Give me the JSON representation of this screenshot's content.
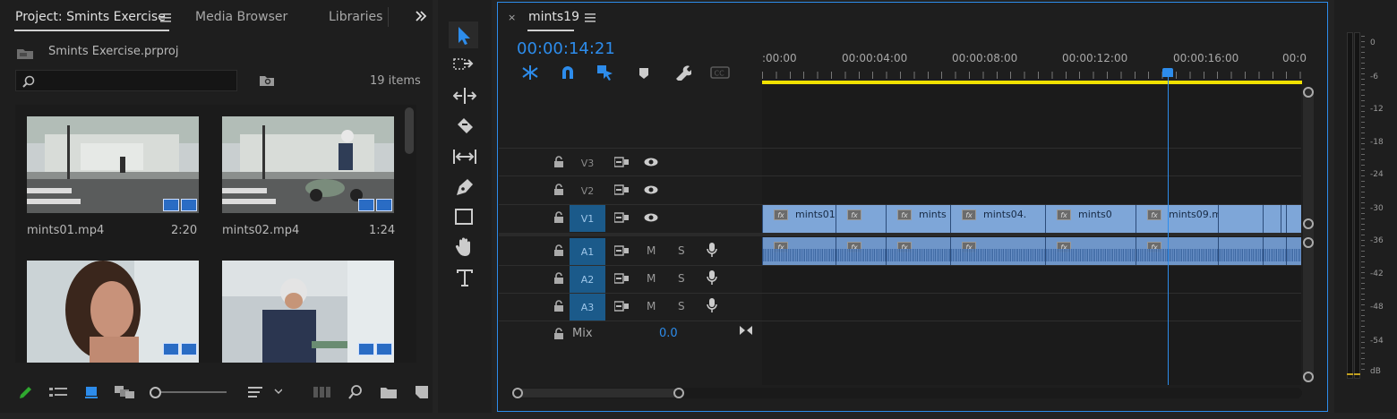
{
  "project_panel": {
    "tabs": [
      "Project: Smints Exercise",
      "Media Browser",
      "Libraries"
    ],
    "file_name": "Smints Exercise.prproj",
    "search_placeholder": "",
    "item_count": "19 items",
    "items": [
      {
        "name": "mints01.mp4",
        "duration": "2:20"
      },
      {
        "name": "mints02.mp4",
        "duration": "1:24"
      },
      {
        "name": "",
        "duration": ""
      },
      {
        "name": "",
        "duration": ""
      }
    ]
  },
  "toolbar": {
    "tools": [
      "selection-tool",
      "track-select-tool",
      "ripple-edit-tool",
      "razor-tool",
      "slip-tool",
      "pen-tool",
      "rectangle-tool",
      "hand-tool",
      "type-tool"
    ]
  },
  "timeline": {
    "sequence_name": "mints19",
    "timecode": "00:00:14:21",
    "ruler": [
      ":00:00",
      "00:00:04:00",
      "00:00:08:00",
      "00:00:12:00",
      "00:00:16:00",
      "00:0"
    ],
    "playhead_seconds": 14.875,
    "video_tracks": [
      {
        "name": "V3",
        "selected": false
      },
      {
        "name": "V2",
        "selected": false
      },
      {
        "name": "V1",
        "selected": true
      }
    ],
    "audio_tracks": [
      {
        "name": "A1",
        "m": "M",
        "s": "S"
      },
      {
        "name": "A2",
        "m": "M",
        "s": "S"
      },
      {
        "name": "A3",
        "m": "M",
        "s": "S"
      }
    ],
    "mix_label": "Mix",
    "mix_value": "0.0",
    "v1_clips": [
      "mints01",
      "",
      "mints",
      "mints04.",
      "mints0",
      "mints09.m"
    ]
  },
  "audio_meter": {
    "labels": [
      "0",
      "-6",
      "-12",
      "-18",
      "-24",
      "-30",
      "-36",
      "-42",
      "-48",
      "-54",
      "dB"
    ]
  },
  "colors": {
    "accent": "#2d8ceb",
    "track_selected": "#1b5a8a",
    "video_clip": "#7ea6d8",
    "work_area": "#f0e100"
  }
}
